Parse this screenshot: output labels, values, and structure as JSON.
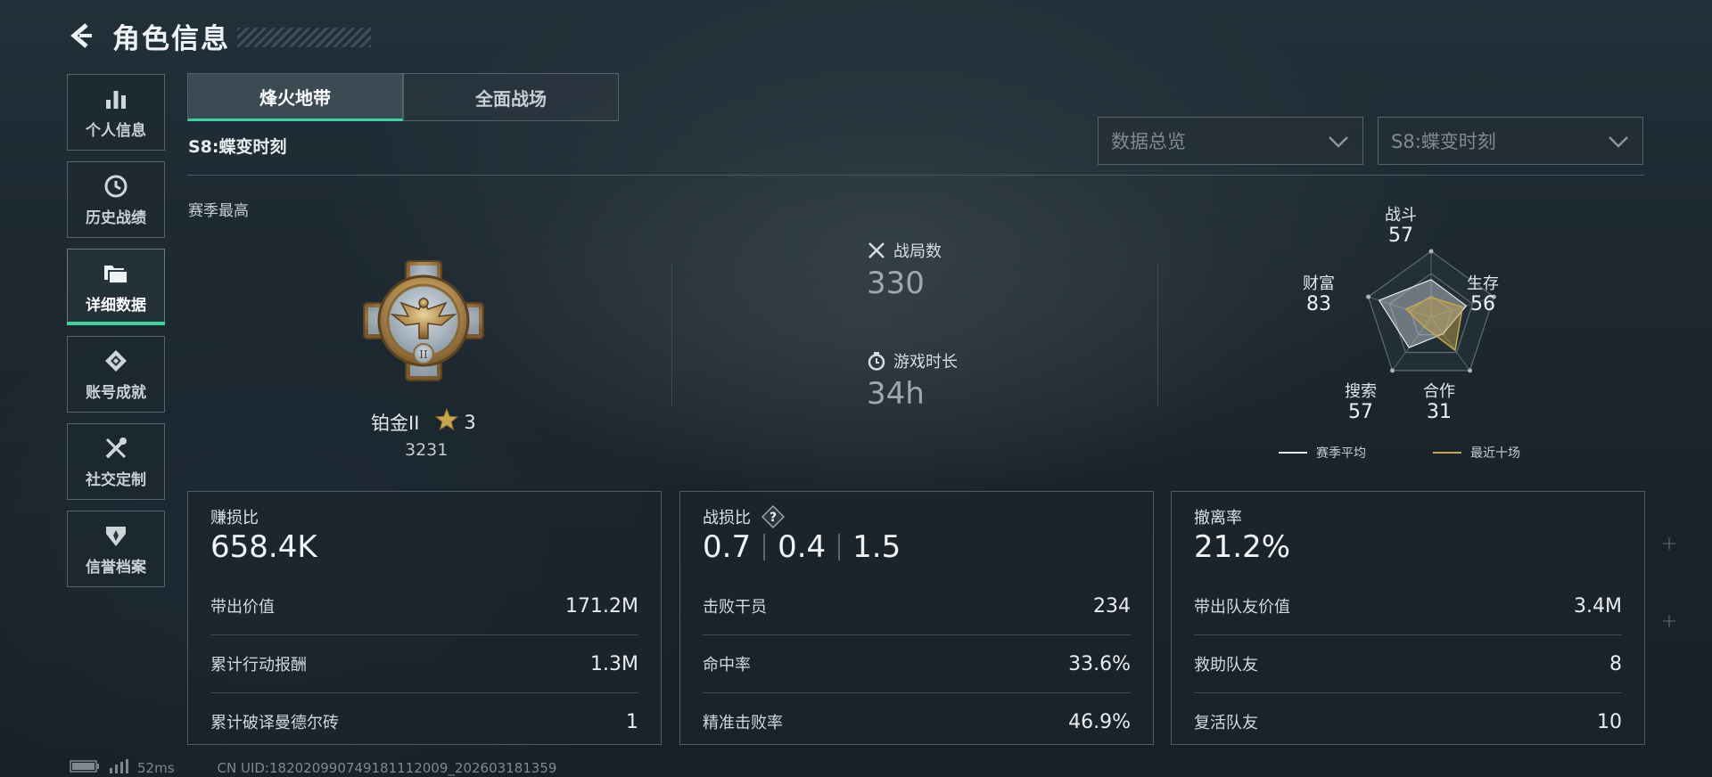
{
  "header": {
    "title": "角色信息"
  },
  "sidebar": {
    "items": [
      {
        "label": "个人信息",
        "icon": "bar-chart-icon"
      },
      {
        "label": "历史战绩",
        "icon": "history-clock-icon"
      },
      {
        "label": "详细数据",
        "icon": "folder-icon",
        "active": true
      },
      {
        "label": "账号成就",
        "icon": "achievement-badge-icon"
      },
      {
        "label": "社交定制",
        "icon": "tools-icon"
      },
      {
        "label": "信誉档案",
        "icon": "credit-emblem-icon"
      }
    ]
  },
  "tabs": [
    {
      "label": "烽火地带",
      "active": true
    },
    {
      "label": "全面战场",
      "active": false
    }
  ],
  "season": {
    "label": "S8:蝶变时刻"
  },
  "filters": {
    "view": "数据总览",
    "season": "S8:蝶变时刻"
  },
  "overview": {
    "season_best_label": "赛季最高",
    "rank_name": "铂金II",
    "rank_stars": "3",
    "rank_score": "3231",
    "matches_label": "战局数",
    "matches_value": "330",
    "playtime_label": "游戏时长",
    "playtime_value": "34h"
  },
  "radar": {
    "axes": [
      {
        "label": "战斗",
        "value": "57",
        "recent": 30
      },
      {
        "label": "生存",
        "value": "56",
        "recent": 50
      },
      {
        "label": "合作",
        "value": "31",
        "recent": 62
      },
      {
        "label": "搜索",
        "value": "57",
        "recent": 18
      },
      {
        "label": "财富",
        "value": "83",
        "recent": 40
      }
    ],
    "legend_avg": "赛季平均",
    "legend_recent": "最近十场",
    "avg_color": "#e6eaee",
    "recent_color": "#c9a64b"
  },
  "cards": {
    "profit": {
      "title": "赚损比",
      "main": "658.4K",
      "rows": [
        {
          "label": "带出价值",
          "value": "171.2M"
        },
        {
          "label": "累计行动报酬",
          "value": "1.3M"
        },
        {
          "label": "累计破译曼德尔砖",
          "value": "1"
        }
      ]
    },
    "combat": {
      "title": "战损比",
      "main_values": [
        "0.7",
        "0.4",
        "1.5"
      ],
      "rows": [
        {
          "label": "击败干员",
          "value": "234"
        },
        {
          "label": "命中率",
          "value": "33.6%"
        },
        {
          "label": "精准击败率",
          "value": "46.9%"
        }
      ]
    },
    "extract": {
      "title": "撤离率",
      "main": "21.2%",
      "rows": [
        {
          "label": "带出队友价值",
          "value": "3.4M"
        },
        {
          "label": "救助队友",
          "value": "8"
        },
        {
          "label": "复活队友",
          "value": "10"
        }
      ]
    }
  },
  "status": {
    "ping": "52ms",
    "uid": "CN UID:182020990749181112009_202603181359"
  }
}
